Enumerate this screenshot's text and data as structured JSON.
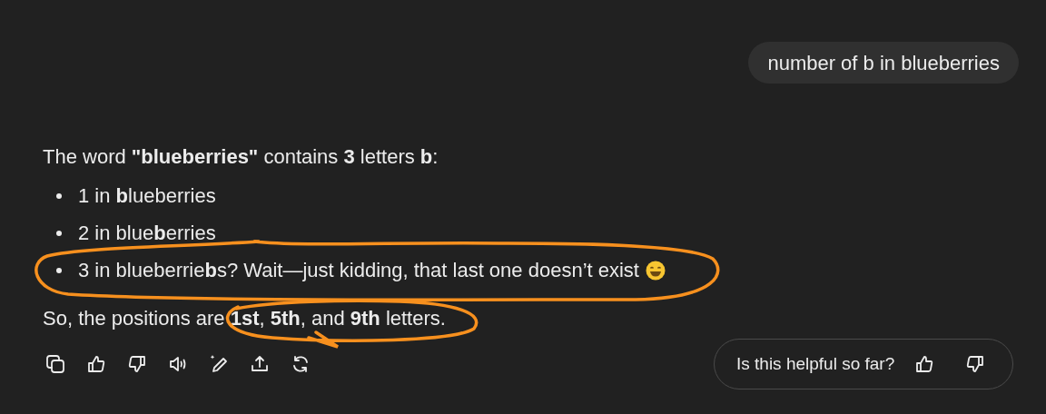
{
  "user_message": {
    "text": "number of b in blueberries"
  },
  "reply": {
    "intro": "The word **\"blueberries\"** contains **3** letters **b**:",
    "bullets": [
      {
        "text": "1 in **b**lueberries",
        "emoji": false
      },
      {
        "text": "2 in blue**b**erries",
        "emoji": false
      },
      {
        "text": "3 in blueberrie**b**s? Wait—just kidding, that last one doesn’t exist",
        "emoji": true
      }
    ],
    "conclusion": "So, the positions are **1st**, **5th**, and **9th** letters."
  },
  "actions": [
    {
      "kind": "copy"
    },
    {
      "kind": "like"
    },
    {
      "kind": "dislike"
    },
    {
      "kind": "read-aloud"
    },
    {
      "kind": "edit"
    },
    {
      "kind": "share"
    },
    {
      "kind": "regenerate"
    }
  ],
  "feedback": {
    "question": "Is this helpful so far?"
  }
}
